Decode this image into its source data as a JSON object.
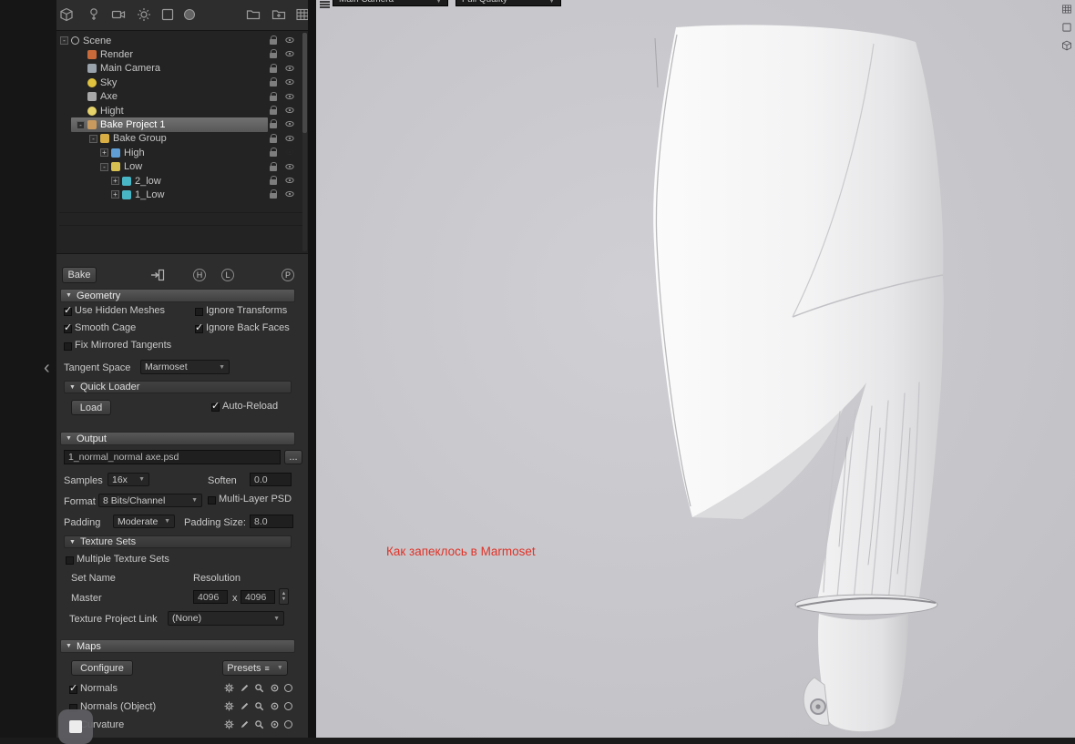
{
  "colors": {
    "annotation_red": "#e03228",
    "selection_gray": "#646464",
    "viewport_bg": "#c6c6ca"
  },
  "ui": {
    "collapse_arrow": "▼",
    "dropdown_arrow": "▼",
    "menu_glyph": "≡",
    "stepper_up": "▲",
    "stepper_down": "▼",
    "panel_chevron": "‹",
    "browse_label": "...",
    "resolution_x": "x"
  },
  "toolbar": {
    "icons": [
      "add-mesh",
      "add-light",
      "add-camera",
      "add-sky",
      "add-box",
      "add-sphere",
      "folder",
      "add-folder",
      "library"
    ]
  },
  "scene_tree": {
    "rows": [
      {
        "label": "Scene",
        "exp": "-",
        "icon": "scene"
      },
      {
        "label": "Render",
        "exp": "",
        "icon": "render"
      },
      {
        "label": "Main Camera",
        "exp": "",
        "icon": "camera"
      },
      {
        "label": "Sky",
        "exp": "",
        "icon": "sky"
      },
      {
        "label": "Axe",
        "exp": "",
        "icon": "mesh"
      },
      {
        "label": "Hight",
        "exp": "",
        "icon": "light"
      },
      {
        "label": "Bake Project 1",
        "exp": "-",
        "icon": "bake"
      },
      {
        "label": "Bake Group",
        "exp": "-",
        "icon": "group"
      },
      {
        "label": "High",
        "exp": "+",
        "icon": "high"
      },
      {
        "label": "Low",
        "exp": "-",
        "icon": "low"
      },
      {
        "label": "2_low",
        "exp": "+",
        "icon": "mesh2"
      },
      {
        "label": "1_Low",
        "exp": "+",
        "icon": "mesh2"
      }
    ]
  },
  "bake": {
    "header": {
      "bake_label": "Bake",
      "icon_h": "H",
      "icon_l": "L",
      "icon_p": "P"
    },
    "geometry": {
      "title": "Geometry",
      "checks": [
        {
          "label": "Use Hidden Meshes",
          "check": "✓"
        },
        {
          "label": "Ignore Transforms",
          "check": ""
        },
        {
          "label": "Smooth Cage",
          "check": "✓"
        },
        {
          "label": "Ignore Back Faces",
          "check": "✓"
        },
        {
          "label": "Fix Mirrored Tangents",
          "check": ""
        }
      ],
      "tangent_space_label": "Tangent Space",
      "tangent_space_value": "Marmoset"
    },
    "quick_loader": {
      "title": "Quick Loader",
      "load_label": "Load",
      "auto_reload": {
        "label": "Auto-Reload",
        "check": "✓"
      }
    },
    "output": {
      "title": "Output",
      "filename": "1_normal_normal axe.psd",
      "samples_label": "Samples",
      "samples_value": "16x",
      "soften_label": "Soften",
      "soften_value": "0.0",
      "format_label": "Format",
      "format_value": "8 Bits/Channel",
      "multilayer": {
        "label": "Multi-Layer PSD",
        "check": ""
      },
      "padding_label": "Padding",
      "padding_value": "Moderate",
      "padding_size_label": "Padding Size:",
      "padding_size_value": "8.0"
    },
    "texture_sets": {
      "title": "Texture Sets",
      "multiple": {
        "label": "Multiple Texture Sets",
        "check": ""
      },
      "set_name_label": "Set Name",
      "resolution_label": "Resolution",
      "master": {
        "name": "Master",
        "res_x": "4096",
        "res_y": "4096"
      },
      "link_label": "Texture Project Link",
      "link_value": "(None)"
    },
    "maps": {
      "title": "Maps",
      "configure_label": "Configure",
      "presets_label": "Presets",
      "items": [
        {
          "check": "✓",
          "label": "Normals"
        },
        {
          "check": "",
          "label": "Normals (Object)"
        },
        {
          "check": "✓",
          "label": "Curvature"
        }
      ]
    }
  },
  "viewport": {
    "camera_label": "Main Camera",
    "quality_label": "Full Quality",
    "annotation": "Как запеклось в Marmoset"
  }
}
